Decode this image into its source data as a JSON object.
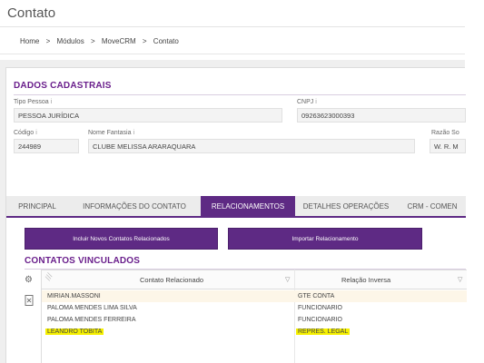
{
  "page": {
    "title": "Contato"
  },
  "breadcrumb": [
    "Home",
    "Módulos",
    "MoveCRM",
    "Contato"
  ],
  "breadcrumb_separator": ">",
  "dados": {
    "section_title": "DADOS CADASTRAIS",
    "tipo_pessoa": {
      "label": "Tipo Pessoa",
      "value": "PESSOA JURÍDICA"
    },
    "cnpj": {
      "label": "CNPJ",
      "value": "09263623000393"
    },
    "codigo": {
      "label": "Código",
      "value": "244989"
    },
    "nome_fantasia": {
      "label": "Nome Fantasia",
      "value": "CLUBE MELISSA ARARAQUARA"
    },
    "razao_social": {
      "label": "Razão So",
      "value": "W. R. M"
    },
    "info_icon": "i"
  },
  "tabs": [
    {
      "label": "PRINCIPAL",
      "active": false
    },
    {
      "label": "INFORMAÇÕES DO CONTATO",
      "active": false
    },
    {
      "label": "RELACIONAMENTOS",
      "active": true
    },
    {
      "label": "DETALHES OPERAÇÕES",
      "active": false
    },
    {
      "label": "CRM - COMEN",
      "active": false
    }
  ],
  "buttons": {
    "incluir": "Incluir Novos Contatos Relacionados",
    "importar": "Importar Relacionamento"
  },
  "contatos": {
    "section_title": "CONTATOS VINCULADOS",
    "columns": [
      "Contato Relacionado",
      "Relação Inversa"
    ],
    "rows": [
      {
        "contato": "MIRIAN.MASSONI",
        "relacao": "GTE CONTA",
        "highlight": false
      },
      {
        "contato": "PALOMA MENDES LIMA SILVA",
        "relacao": "FUNCIONARIO",
        "highlight": false
      },
      {
        "contato": "PALOMA MENDES FERREIRA",
        "relacao": "FUNCIONARIO",
        "highlight": false
      },
      {
        "contato": "LEANDRO TOBITA",
        "relacao": "REPRES. LEGAL",
        "highlight": true
      }
    ]
  },
  "icons": {
    "settings": "gear-icon",
    "export": "export-file-icon",
    "filter": "filter-icon"
  },
  "colors": {
    "accent": "#5e2a84",
    "section_title": "#6a1f8c",
    "highlight": "#f5f000",
    "row_alt": "#fdf6e8"
  }
}
